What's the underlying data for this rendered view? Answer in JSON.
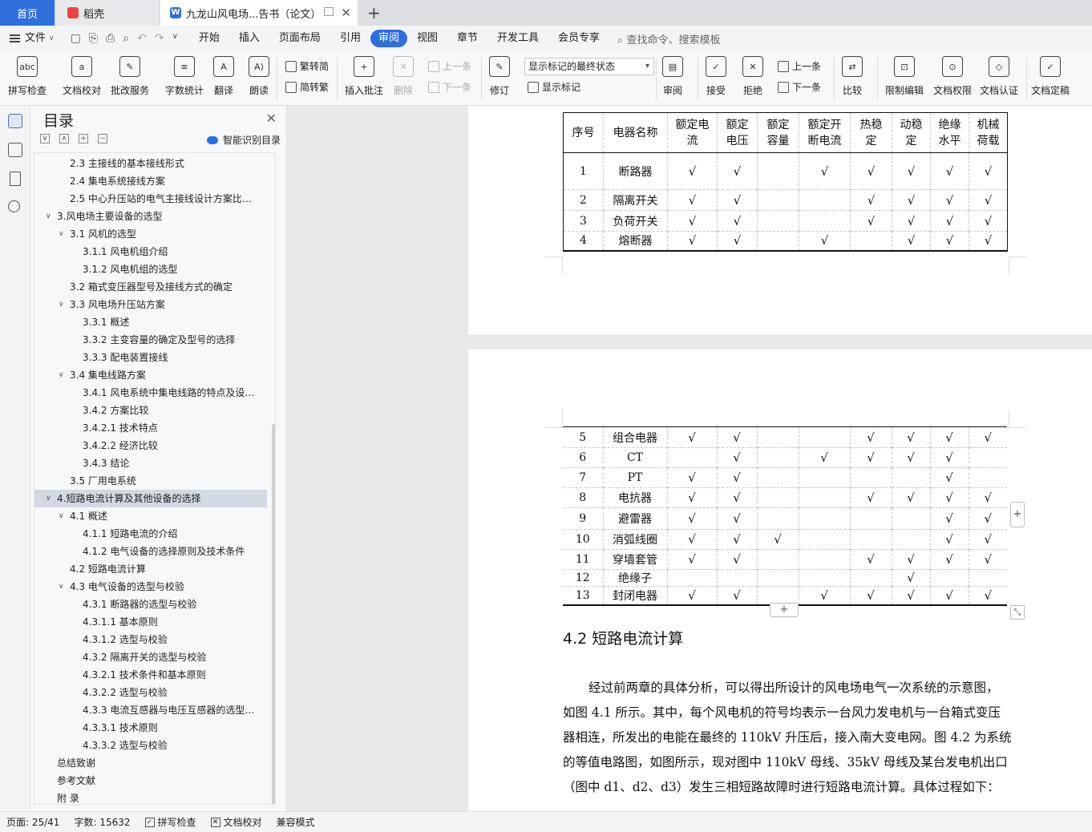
{
  "tabs": {
    "home": "首页",
    "daoke": "稻壳",
    "document": "九龙山风电场...告书（论文）"
  },
  "menu": {
    "file": "文件",
    "tabs": [
      "开始",
      "插入",
      "页面布局",
      "引用",
      "审阅",
      "视图",
      "章节",
      "开发工具",
      "会员专享"
    ],
    "active_tab": "审阅",
    "search": "查找命令、搜索模板"
  },
  "ribbon": {
    "spell_check": "拼写检查",
    "doc_proofread": "文档校对",
    "batch_service": "批改服务",
    "word_count": "字数统计",
    "translate": "翻译",
    "read_aloud": "朗读",
    "to_traditional": "繁转简",
    "to_simplified": "简转繁",
    "insert_comment": "插入批注",
    "delete": "删除",
    "prev_comment": "上一条",
    "next_comment": "下一条",
    "track_changes": "修订",
    "markup_mode": "显示标记的最终状态",
    "show_markup": "显示标记",
    "review": "审阅",
    "accept": "接受",
    "reject": "拒绝",
    "prev_change": "上一条",
    "next_change": "下一条",
    "compare": "比较",
    "restrict_edit": "限制编辑",
    "doc_permission": "文档权限",
    "doc_certify": "文档认证",
    "doc_finalize": "文档定稿"
  },
  "toc": {
    "title": "目录",
    "smart": "智能识别目录",
    "items": [
      {
        "label": "2.3  主接线的基本接线形式",
        "level": 2,
        "caret": ""
      },
      {
        "label": "2.4  集电系统接线方案",
        "level": 2,
        "caret": ""
      },
      {
        "label": "2.5  中心升压站的电气主接线设计方案比…",
        "level": 2,
        "caret": ""
      },
      {
        "label": "3.风电场主要设备的选型",
        "level": 1,
        "caret": "v"
      },
      {
        "label": "3.1  风机的选型",
        "level": 2,
        "caret": "v"
      },
      {
        "label": "3.1.1  风电机组介绍",
        "level": 3,
        "caret": ""
      },
      {
        "label": "3.1.2  风电机组的选型",
        "level": 3,
        "caret": ""
      },
      {
        "label": "3.2  箱式变压器型号及接线方式的确定",
        "level": 2,
        "caret": ""
      },
      {
        "label": "3.3  风电场升压站方案",
        "level": 2,
        "caret": "v"
      },
      {
        "label": "3.3.1  概述",
        "level": 3,
        "caret": ""
      },
      {
        "label": "3.3.2  主变容量的确定及型号的选择",
        "level": 3,
        "caret": ""
      },
      {
        "label": "3.3.3  配电装置接线",
        "level": 3,
        "caret": ""
      },
      {
        "label": "3.4  集电线路方案",
        "level": 2,
        "caret": "v"
      },
      {
        "label": "3.4.1  风电系统中集电线路的特点及设…",
        "level": 3,
        "caret": ""
      },
      {
        "label": "3.4.2  方案比较",
        "level": 3,
        "caret": ""
      },
      {
        "label": "3.4.2.1  技术特点",
        "level": 3,
        "caret": ""
      },
      {
        "label": "3.4.2.2  经济比较",
        "level": 3,
        "caret": ""
      },
      {
        "label": "3.4.3  结论",
        "level": 3,
        "caret": ""
      },
      {
        "label": "3.5  厂用电系统",
        "level": 2,
        "caret": ""
      },
      {
        "label": "4.短路电流计算及其他设备的选择",
        "level": 1,
        "caret": "v",
        "selected": true
      },
      {
        "label": "4.1  概述",
        "level": 2,
        "caret": "v"
      },
      {
        "label": "4.1.1  短路电流的介绍",
        "level": 3,
        "caret": ""
      },
      {
        "label": "4.1.2  电气设备的选择原则及技术条件",
        "level": 3,
        "caret": ""
      },
      {
        "label": "4.2  短路电流计算",
        "level": 2,
        "caret": ""
      },
      {
        "label": "4.3  电气设备的选型与校验",
        "level": 2,
        "caret": "v"
      },
      {
        "label": "4.3.1  断路器的选型与校验",
        "level": 3,
        "caret": ""
      },
      {
        "label": "4.3.1.1  基本原则",
        "level": 3,
        "caret": ""
      },
      {
        "label": "4.3.1.2  选型与校验",
        "level": 3,
        "caret": ""
      },
      {
        "label": "4.3.2  隔离开关的选型与校验",
        "level": 3,
        "caret": ""
      },
      {
        "label": "4.3.2.1  技术条件和基本原则",
        "level": 3,
        "caret": ""
      },
      {
        "label": "4.3.2.2  选型与校验",
        "level": 3,
        "caret": ""
      },
      {
        "label": "4.3.3  电流互感器与电压互感器的选型…",
        "level": 3,
        "caret": ""
      },
      {
        "label": "4.3.3.1  技术原则",
        "level": 3,
        "caret": ""
      },
      {
        "label": "4.3.3.2  选型与校验",
        "level": 3,
        "caret": ""
      },
      {
        "label": "总结致谢",
        "level": 1,
        "caret": ""
      },
      {
        "label": "参考文献",
        "level": 1,
        "caret": ""
      },
      {
        "label": "附    录",
        "level": 1,
        "caret": ""
      }
    ]
  },
  "table": {
    "headers": [
      [
        "序号"
      ],
      [
        "电器名称"
      ],
      [
        "额定电",
        "流"
      ],
      [
        "额定",
        "电压"
      ],
      [
        "额定",
        "容量"
      ],
      [
        "额定开",
        "断电流"
      ],
      [
        "热稳",
        "定"
      ],
      [
        "动稳",
        "定"
      ],
      [
        "绝缘",
        "水平"
      ],
      [
        "机械",
        "荷载"
      ]
    ],
    "check_mark": "√",
    "rows_page1": [
      {
        "no": "1",
        "name": "断路器",
        "checks": [
          1,
          1,
          0,
          1,
          1,
          1,
          1,
          1
        ]
      },
      {
        "no": "2",
        "name": "隔离开关",
        "checks": [
          1,
          1,
          0,
          0,
          1,
          1,
          1,
          1
        ]
      },
      {
        "no": "3",
        "name": "负荷开关",
        "checks": [
          1,
          1,
          0,
          0,
          1,
          1,
          1,
          1
        ]
      },
      {
        "no": "4",
        "name": "熔断器",
        "checks": [
          1,
          1,
          0,
          1,
          0,
          1,
          1,
          1
        ]
      }
    ],
    "rows_page2": [
      {
        "no": "5",
        "name": "组合电器",
        "checks": [
          1,
          1,
          0,
          0,
          1,
          1,
          1,
          1
        ]
      },
      {
        "no": "6",
        "name": "CT",
        "checks": [
          0,
          1,
          0,
          1,
          1,
          1,
          1,
          0
        ]
      },
      {
        "no": "7",
        "name": "PT",
        "checks": [
          1,
          1,
          0,
          0,
          0,
          0,
          1,
          0
        ]
      },
      {
        "no": "8",
        "name": "电抗器",
        "checks": [
          1,
          1,
          0,
          0,
          1,
          1,
          1,
          1
        ]
      },
      {
        "no": "9",
        "name": "避雷器",
        "checks": [
          1,
          1,
          0,
          0,
          0,
          0,
          1,
          1
        ]
      },
      {
        "no": "10",
        "name": "消弧线圈",
        "checks": [
          1,
          1,
          1,
          0,
          0,
          0,
          1,
          1
        ]
      },
      {
        "no": "11",
        "name": "穿墙套管",
        "checks": [
          1,
          1,
          0,
          0,
          1,
          1,
          1,
          1
        ]
      },
      {
        "no": "12",
        "name": "绝缘子",
        "checks": [
          0,
          0,
          0,
          0,
          0,
          1,
          0,
          0
        ]
      },
      {
        "no": "13",
        "name": "封闭电器",
        "checks": [
          1,
          1,
          0,
          1,
          1,
          1,
          1,
          1
        ]
      }
    ]
  },
  "document": {
    "section_heading": "4.2  短路电流计算",
    "paragraph_lines": [
      "经过前两章的具体分析，可以得出所设计的风电场电气一次系统的示意图，",
      "如图 4.1 所示。其中，每个风电机的符号均表示一台风力发电机与一台箱式变压",
      "器相连，所发出的电能在最终的 110kV 升压后，接入南大变电网。图 4.2 为系统",
      "的等值电路图，如图所示，现对图中 110kV 母线、35kV 母线及某台发电机出口",
      "（图中 d1、d2、d3）发生三相短路故障时进行短路电流计算。具体过程如下："
    ],
    "table_add_button": "+",
    "column_add_button": "+"
  },
  "status": {
    "page": "页面: 25/41",
    "word_count": "字数: 15632",
    "spell_check": "拼写检查",
    "proofread": "文档校对",
    "compat_mode": "兼容模式"
  },
  "colors": {
    "accent": "#2e6fdc",
    "toc_selected": "#d3d9e3",
    "page_background": "#e9e9ea"
  }
}
